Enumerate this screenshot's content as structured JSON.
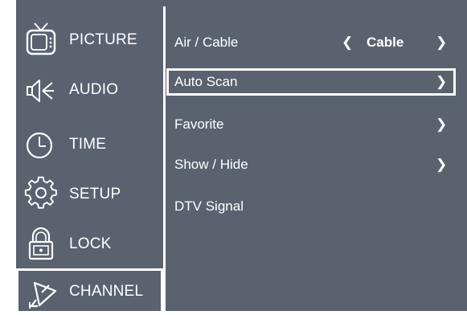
{
  "sidebar": {
    "items": [
      {
        "label": "PICTURE",
        "icon": "tv-icon"
      },
      {
        "label": "AUDIO",
        "icon": "speaker-icon"
      },
      {
        "label": "TIME",
        "icon": "clock-icon"
      },
      {
        "label": "SETUP",
        "icon": "gear-icon"
      },
      {
        "label": "LOCK",
        "icon": "lock-icon"
      },
      {
        "label": "CHANNEL",
        "icon": "satellite-dish-icon",
        "selected": true
      }
    ]
  },
  "menu": {
    "air_cable": {
      "label": "Air / Cable",
      "value": "Cable",
      "left_arrow": "❮",
      "right_arrow": "❯"
    },
    "auto_scan": {
      "label": "Auto Scan",
      "arrow": "❯",
      "selected": true
    },
    "favorite": {
      "label": "Favorite",
      "arrow": "❯"
    },
    "show_hide": {
      "label": "Show / Hide",
      "arrow": "❯"
    },
    "dtv_signal": {
      "label": "DTV Signal"
    }
  },
  "colors": {
    "background": "#5a6270",
    "text": "#ffffff",
    "highlight_border": "#ffffff"
  }
}
